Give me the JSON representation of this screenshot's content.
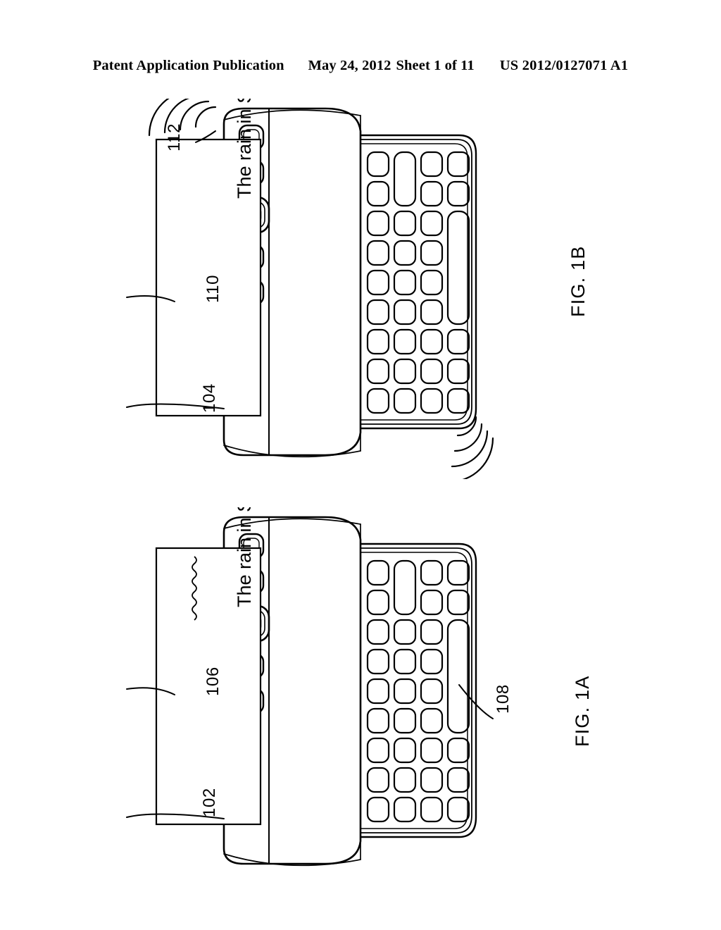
{
  "header": {
    "publication": "Patent Application Publication",
    "date": "May 24, 2012",
    "sheet": "Sheet 1 of 11",
    "patent_number": "US 2012/0127071 A1"
  },
  "figures": [
    {
      "id": "fig1b",
      "caption": "FIG. 1B",
      "screen_text": "The rain in Spain",
      "screen_text_misspelled": false,
      "reference_numerals": [
        {
          "label": "112",
          "points_to": "vibration-waves-top-left"
        },
        {
          "label": "110",
          "points_to": "screen-text"
        },
        {
          "label": "104",
          "points_to": "device-body"
        }
      ],
      "vibration_indicators": [
        {
          "name": "waves-top-left",
          "arcs": 4
        },
        {
          "name": "waves-bottom-right",
          "arcs": 4
        }
      ]
    },
    {
      "id": "fig1a",
      "caption": "FIG. 1A",
      "screen_text": "The rain in Soain",
      "screen_text_misspelled": true,
      "reference_numerals": [
        {
          "label": "106",
          "points_to": "screen-text"
        },
        {
          "label": "102",
          "points_to": "device-body"
        },
        {
          "label": "108",
          "points_to": "spacebar-key"
        }
      ],
      "vibration_indicators": []
    }
  ],
  "device": {
    "type": "slider-phone-with-qwerty-keyboard",
    "front_buttons": [
      {
        "name": "button-left-outer",
        "shape": "rounded-square"
      },
      {
        "name": "button-left-inner",
        "shape": "rounded-square"
      },
      {
        "name": "navigation-trackpad-button",
        "shape": "rounded-square-large"
      },
      {
        "name": "button-right-inner",
        "shape": "rounded-square"
      },
      {
        "name": "button-right-outer",
        "shape": "rounded-square"
      }
    ],
    "keyboard": {
      "rows": 9,
      "columns": 4,
      "special_keys": [
        {
          "name": "tall-key-column2-rows1-2",
          "span_rows": 2
        },
        {
          "name": "spacebar-column4-rows3-6",
          "span_rows": 4
        }
      ]
    }
  },
  "colors": {
    "line": "#000000",
    "background": "#ffffff"
  }
}
